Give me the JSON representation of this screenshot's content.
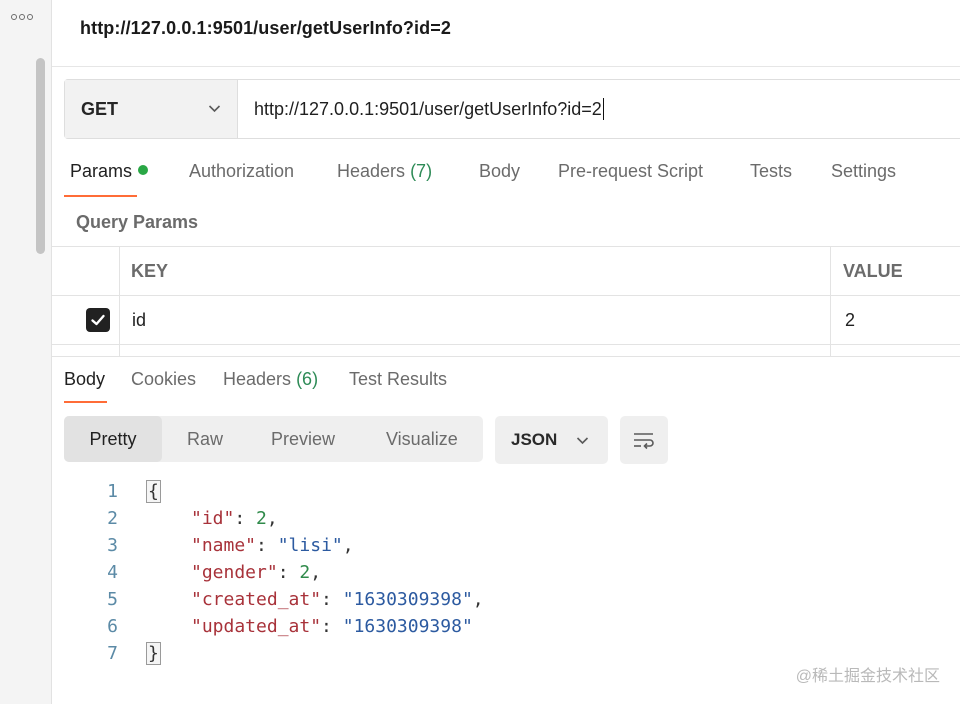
{
  "request": {
    "title": "http://127.0.0.1:9501/user/getUserInfo?id=2",
    "method": "GET",
    "url": "http://127.0.0.1:9501/user/getUserInfo?id=2",
    "tabs": [
      {
        "label": "Params",
        "count": ""
      },
      {
        "label": "Authorization",
        "count": ""
      },
      {
        "label": "Headers",
        "count": "(7)"
      },
      {
        "label": "Body",
        "count": ""
      },
      {
        "label": "Pre-request Script",
        "count": ""
      },
      {
        "label": "Tests",
        "count": ""
      },
      {
        "label": "Settings",
        "count": ""
      }
    ],
    "active_tab": "Params",
    "query_params_label": "Query Params",
    "params_table": {
      "headers": [
        "KEY",
        "VALUE"
      ],
      "rows": [
        {
          "checked": true,
          "key": "id",
          "value": "2"
        }
      ]
    }
  },
  "response": {
    "tabs": [
      {
        "label": "Body",
        "count": ""
      },
      {
        "label": "Cookies",
        "count": ""
      },
      {
        "label": "Headers",
        "count": "(6)"
      },
      {
        "label": "Test Results",
        "count": ""
      }
    ],
    "active_tab": "Body",
    "view_modes": [
      "Pretty",
      "Raw",
      "Preview",
      "Visualize"
    ],
    "active_view_mode": "Pretty",
    "format": "JSON",
    "lines": [
      {
        "n": "1",
        "tokens": [
          {
            "t": "brace",
            "v": "{"
          }
        ]
      },
      {
        "n": "2",
        "tokens": [
          {
            "t": "key",
            "v": "\"id\""
          },
          {
            "t": "punct",
            "v": ": "
          },
          {
            "t": "num",
            "v": "2"
          },
          {
            "t": "punct",
            "v": ","
          }
        ]
      },
      {
        "n": "3",
        "tokens": [
          {
            "t": "key",
            "v": "\"name\""
          },
          {
            "t": "punct",
            "v": ": "
          },
          {
            "t": "str",
            "v": "\"lisi\""
          },
          {
            "t": "punct",
            "v": ","
          }
        ]
      },
      {
        "n": "4",
        "tokens": [
          {
            "t": "key",
            "v": "\"gender\""
          },
          {
            "t": "punct",
            "v": ": "
          },
          {
            "t": "num",
            "v": "2"
          },
          {
            "t": "punct",
            "v": ","
          }
        ]
      },
      {
        "n": "5",
        "tokens": [
          {
            "t": "key",
            "v": "\"created_at\""
          },
          {
            "t": "punct",
            "v": ": "
          },
          {
            "t": "str",
            "v": "\"1630309398\""
          },
          {
            "t": "punct",
            "v": ","
          }
        ]
      },
      {
        "n": "6",
        "tokens": [
          {
            "t": "key",
            "v": "\"updated_at\""
          },
          {
            "t": "punct",
            "v": ": "
          },
          {
            "t": "str",
            "v": "\"1630309398\""
          }
        ]
      },
      {
        "n": "7",
        "tokens": [
          {
            "t": "brace",
            "v": "}"
          }
        ]
      }
    ]
  },
  "watermark": "@稀土掘金技术社区",
  "colors": {
    "accent": "#ff6c37",
    "status_dot": "#29a745",
    "count_green": "#2e8b57",
    "json_key": "#a8323a",
    "json_string": "#2c5aa0",
    "json_number": "#2f8a4a"
  },
  "icons": {
    "rail_menu": "more-dots-icon",
    "method_dropdown": "chevron-down-icon",
    "format_dropdown": "chevron-down-icon",
    "wrap_toggle": "wrap-lines-icon",
    "param_checkbox": "checkmark-icon"
  }
}
